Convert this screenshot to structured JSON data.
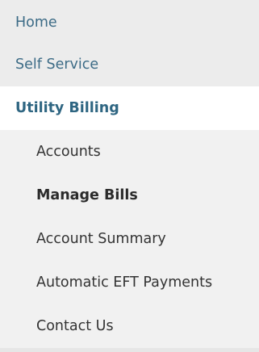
{
  "nav": {
    "top_items": [
      {
        "label": "Home"
      },
      {
        "label": "Self Service"
      },
      {
        "label": "Utility Billing"
      }
    ],
    "sub_items": [
      {
        "label": "Accounts"
      },
      {
        "label": "Manage Bills"
      },
      {
        "label": "Account Summary"
      },
      {
        "label": "Automatic EFT Payments"
      },
      {
        "label": "Contact Us"
      }
    ],
    "active_section": "Utility Billing",
    "current_page": "Manage Bills"
  },
  "colors": {
    "link_blue": "#3c6b86",
    "active_blue": "#2f6682",
    "top_bg": "#ececec",
    "sub_bg": "#f1f1f1",
    "text_dark": "#333333"
  }
}
